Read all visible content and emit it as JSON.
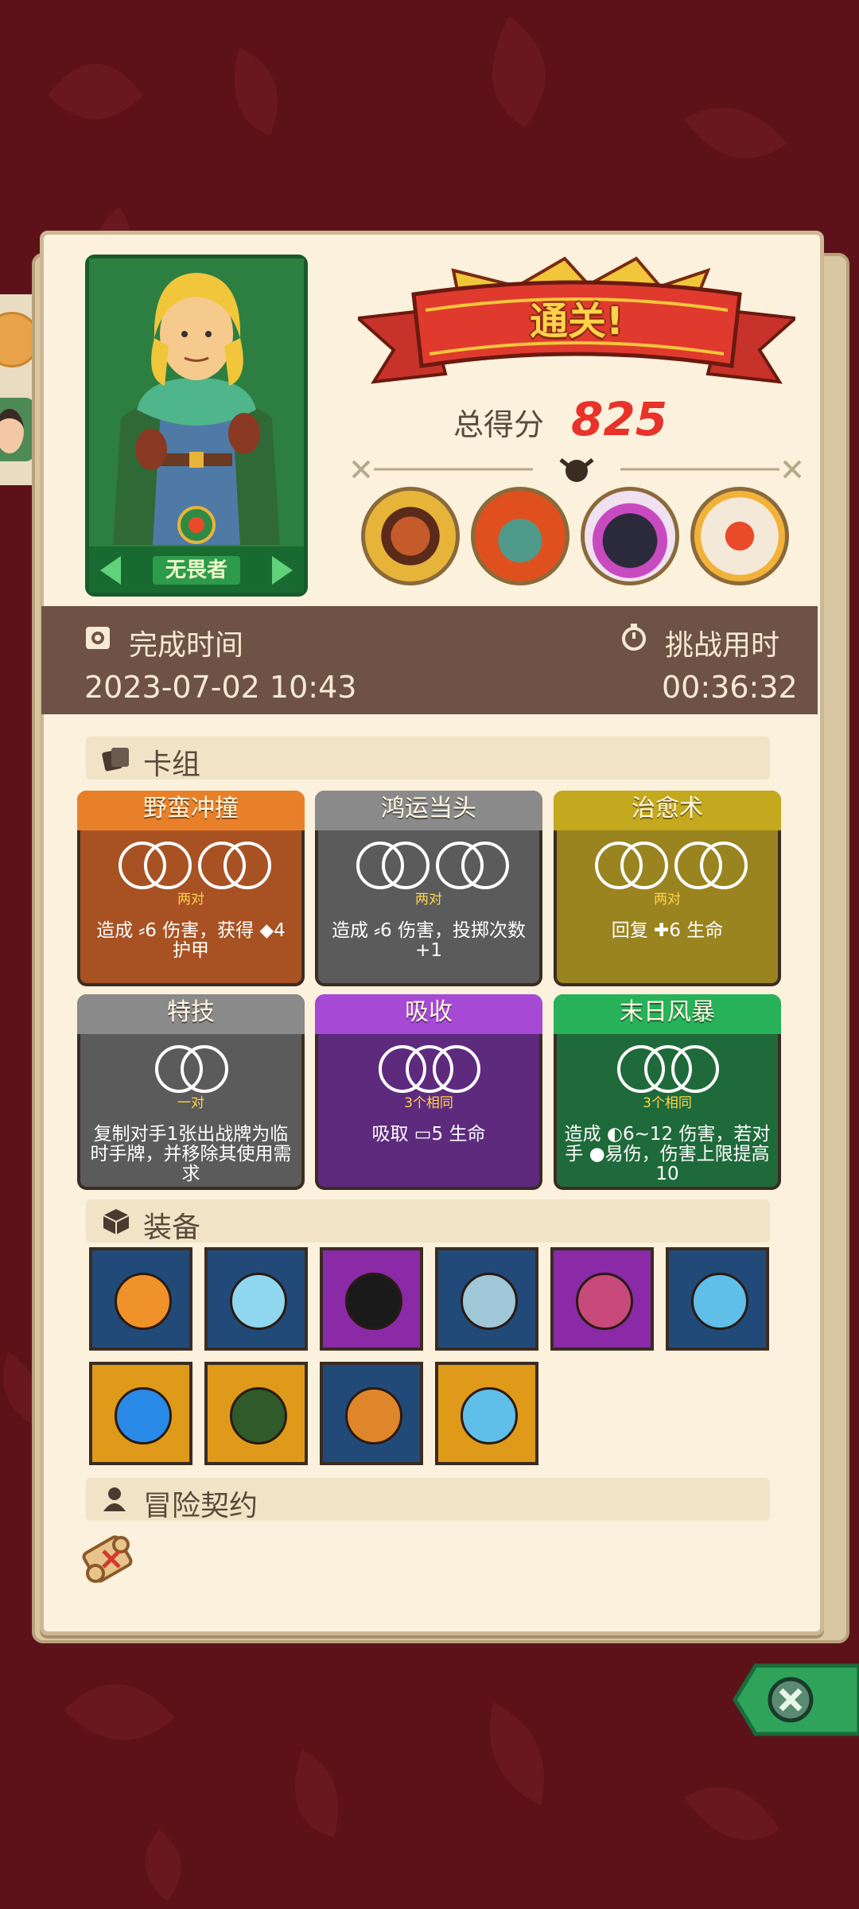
{
  "hero": {
    "name": "无畏者"
  },
  "result": {
    "banner": "通关!",
    "score_label": "总得分",
    "score": "825"
  },
  "bosses": [
    "boss-cyclops",
    "boss-fire-ogre",
    "boss-dark-beast",
    "boss-demon-mask"
  ],
  "times": {
    "finish_label": "完成时间",
    "finish_value": "2023-07-02 10:43",
    "challenge_label": "挑战用时",
    "challenge_value": "00:36:32"
  },
  "deck": {
    "title": "卡组",
    "cards": [
      {
        "name": "野蛮冲撞",
        "combo": "两对",
        "desc": "造成 ⸗6 伤害，获得 ◆4 护甲"
      },
      {
        "name": "鸿运当头",
        "combo": "两对",
        "desc": "造成 ⸗6 伤害，投掷次数 +1"
      },
      {
        "name": "治愈术",
        "combo": "两对",
        "desc": "回复 ✚6 生命"
      },
      {
        "name": "特技",
        "combo": "一对",
        "desc": "复制对手1张出战牌为临时手牌，并移除其使用需求"
      },
      {
        "name": "吸收",
        "combo": "3个相同",
        "desc": "吸取 ▭5 生命"
      },
      {
        "name": "末日风暴",
        "combo": "3个相同",
        "desc": "造成 ◐6~12 伤害，若对手 ●易伤，伤害上限提高10"
      }
    ],
    "colors": [
      "#a85223",
      "#5b5b5b",
      "#9a8420",
      "#5b5b5b",
      "#5e2a7e",
      "#1f6a3a"
    ]
  },
  "equipment": {
    "title": "装备",
    "items": [
      "lightning-orb-icon",
      "crystal-icon",
      "shattered-rune-icon",
      "axe-icon",
      "dagger-icon",
      "ice-crown-icon",
      "water-orb-icon",
      "green-horn-icon",
      "sprout-pot-icon",
      "ice-shield-icon"
    ]
  },
  "contract": {
    "title": "冒险契约"
  }
}
